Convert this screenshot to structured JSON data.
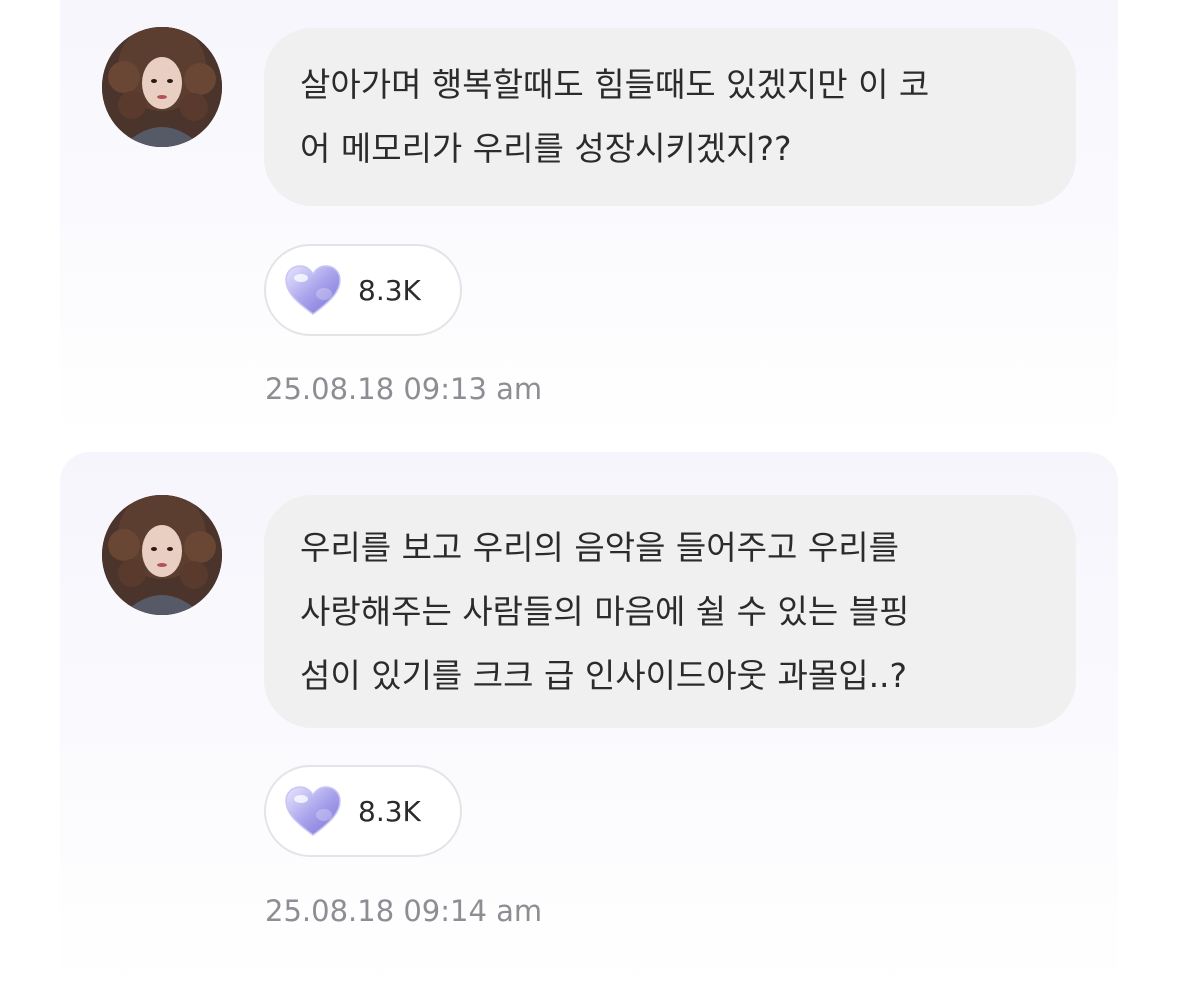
{
  "posts": [
    {
      "message_lines": [
        "살아가며 행복할때도 힘들때도 있겠지만 이 코",
        "어 메모리가 우리를 성장시키겠지??"
      ],
      "like_count": "8.3K",
      "like_icon": "heart-icon",
      "timestamp": "25.08.18 09:13 am"
    },
    {
      "message_lines": [
        "우리를 보고 우리의 음악을 들어주고 우리를",
        "사랑해주는 사람들의 마음에 쉴 수 있는 블핑",
        "섬이 있기를 크크 급 인사이드아웃 과몰입..?"
      ],
      "like_count": "8.3K",
      "like_icon": "heart-icon",
      "timestamp": "25.08.18 09:14 am"
    }
  ],
  "colors": {
    "bubble": "#f0f0f0",
    "heart": "#a9a4ec",
    "timestamp": "#8d8d93"
  }
}
